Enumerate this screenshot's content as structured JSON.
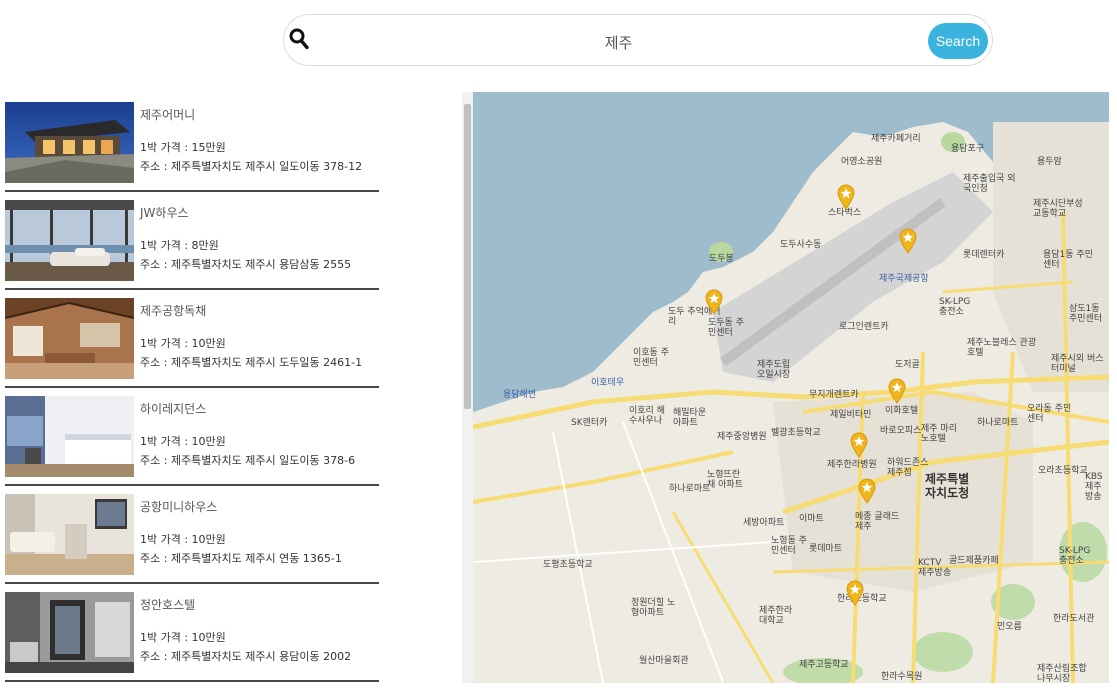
{
  "search": {
    "query": "제주",
    "button_label": "Search"
  },
  "listings": [
    {
      "name": "제주어머니",
      "price": "1박 가격 : 15만원",
      "address": "주소 : 제주특별자치도 제주시 일도이동 378-12"
    },
    {
      "name": "JW하우스",
      "price": "1박 가격 : 8만원",
      "address": "주소 : 제주특별자치도 제주시 용담삼동 2555"
    },
    {
      "name": "제주공항독채",
      "price": "1박 가격 : 10만원",
      "address": "주소 : 제주특별자치도 제주시 도두일동 2461-1"
    },
    {
      "name": "하이레지던스",
      "price": "1박 가격 : 10만원",
      "address": "주소 : 제주특별자치도 제주시 일도이동 378-6"
    },
    {
      "name": "공항미니하우스",
      "price": "1박 가격 : 10만원",
      "address": "주소 : 제주특별자치도 제주시 연동 1365-1"
    },
    {
      "name": "정안호스텔",
      "price": "1박 가격 : 10만원",
      "address": "주소 : 제주특별자치도 제주시 용담이동 2002"
    }
  ],
  "map": {
    "labels": {
      "l1": "제주카페거리",
      "l2": "용담포구",
      "l3": "어영소공원",
      "l4": "용두암",
      "l5": "스타벅스",
      "l6": "제주출입국 외국인청",
      "l7": "제주시단부성 교동학교",
      "l8": "도두봉",
      "l9": "도두사수동",
      "l10": "제주국제공항",
      "l11": "롯데렌터카",
      "l12": "용담1동 주민센터",
      "l13": "도두 추억애거리",
      "l14": "도두동 주민센터",
      "l15": "SK-LPG 충전소",
      "l16": "로그인렌트카",
      "l17": "삼도1동 주민센터",
      "l18": "이호동 주민센터",
      "l19": "이호테우",
      "l20": "제주도립 오일시장",
      "l21": "제주노블레스 관광호텔",
      "l22": "도저골",
      "l23": "제주시외 버스터미널",
      "l24": "용담해변",
      "l25": "무지개렌트카",
      "l26": "이화호텔",
      "l27": "SK렌터카",
      "l28": "이호리 해수사우나",
      "l29": "해밀타운 아파트",
      "l30": "제일비타민",
      "l31": "오라동 주민센터",
      "l32": "하나로마트",
      "l33": "제주중앙병원",
      "l34": "벨광초등학교",
      "l35": "바로오피스",
      "l36": "제주 마리노호텔",
      "l37": "제주한라병원",
      "l38": "하워드존스 제주점",
      "l39": "제주특별 자치도청",
      "l40": "오라초등학교",
      "l41": "KBS 제주방송",
      "l42": "노형뜨란채 아파트",
      "l43": "하나로마트",
      "l44": "이마트",
      "l45": "메종 글래드제주",
      "l46": "세방아파트",
      "l47": "노형동 주민센터",
      "l48": "롯데마트",
      "l49": "KCTV 제주방송",
      "l50": "골드제품카페",
      "l51": "SK-LPG 충전소",
      "l52": "도평초등학교",
      "l53": "한라초등학교",
      "l54": "정원더힐 노형아파트",
      "l55": "제주한라 대학교",
      "l56": "민오름",
      "l57": "한라도서관",
      "l58": "월산마을회관",
      "l59": "제주고등학교",
      "l60": "한라수목원",
      "l61": "제주산림조합 나무시장"
    }
  },
  "colors": {
    "accent": "#3ab4de",
    "sea": "#9fbccc",
    "land": "#eeebe2",
    "road": "#f7dc74",
    "marker": "#f1b41b"
  }
}
